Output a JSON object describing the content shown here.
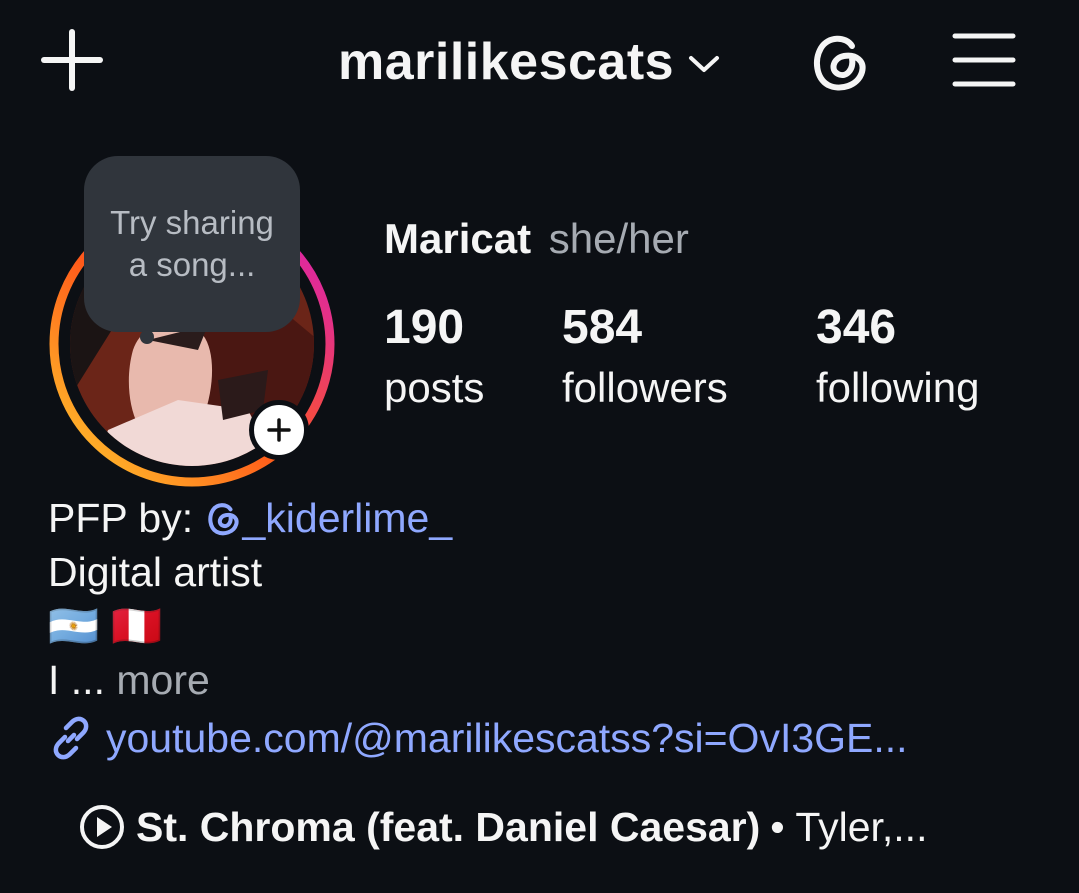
{
  "header": {
    "username": "marilikescats"
  },
  "note": {
    "text": "Try sharing a song..."
  },
  "profile": {
    "display_name": "Maricat",
    "pronouns": "she/her"
  },
  "stats": [
    {
      "value": "190",
      "label": "posts"
    },
    {
      "value": "584",
      "label": "followers"
    },
    {
      "value": "346",
      "label": "following"
    }
  ],
  "bio": {
    "pfp_prefix": "PFP by: ",
    "pfp_handle": "_kiderlime_",
    "line2": "Digital artist",
    "flags": [
      "🇦🇷",
      "🇵🇪"
    ],
    "line4_prefix": "I ... ",
    "more": "more"
  },
  "link": {
    "text": "youtube.com/@marilikescatss?si=OvI3GE..."
  },
  "music": {
    "title": "St. Chroma (feat. Daniel Caesar)",
    "separator": " • ",
    "artist": "Tyler,..."
  },
  "colors": {
    "background": "#0c0f14",
    "link": "#8fa8ff",
    "muted": "#a6abb2",
    "bubble": "#30353c"
  }
}
